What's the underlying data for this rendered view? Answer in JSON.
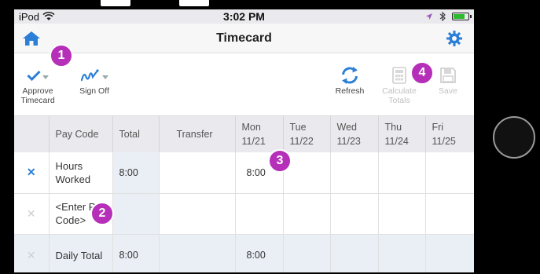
{
  "status_bar": {
    "carrier": "iPod",
    "time": "3:02 PM"
  },
  "header": {
    "title": "Timecard",
    "home_icon": "home-icon",
    "settings_icon": "gear-icon"
  },
  "toolbar": {
    "approve_label_line1": "Approve",
    "approve_label_line2": "Timecard",
    "signoff_label": "Sign Off",
    "refresh_label": "Refresh",
    "calculate_label_line1": "Calculate",
    "calculate_label_line2": "Totals",
    "save_label": "Save"
  },
  "callouts": [
    "1",
    "2",
    "3",
    "4"
  ],
  "table": {
    "headers": {
      "pay_code": "Pay Code",
      "total": "Total",
      "transfer": "Transfer",
      "days": [
        {
          "day": "Mon",
          "date": "11/21"
        },
        {
          "day": "Tue",
          "date": "11/22"
        },
        {
          "day": "Wed",
          "date": "11/23"
        },
        {
          "day": "Thu",
          "date": "11/24"
        },
        {
          "day": "Fri",
          "date": "11/25"
        }
      ]
    },
    "rows": [
      {
        "marker": "✕",
        "pay_code": "Hours Worked",
        "total": "8:00",
        "transfer": "",
        "mon": "8:00"
      },
      {
        "marker": "✕",
        "pay_code": "<Enter Pay Code>",
        "total": "",
        "transfer": "",
        "mon": ""
      },
      {
        "marker": "✕",
        "pay_code": "Daily Total",
        "total": "8:00",
        "transfer": "",
        "mon": "8:00"
      }
    ]
  },
  "colors": {
    "accent_blue": "#2c7fd6",
    "badge_purple": "#b52fb8",
    "battery_green": "#2cbb2c"
  }
}
